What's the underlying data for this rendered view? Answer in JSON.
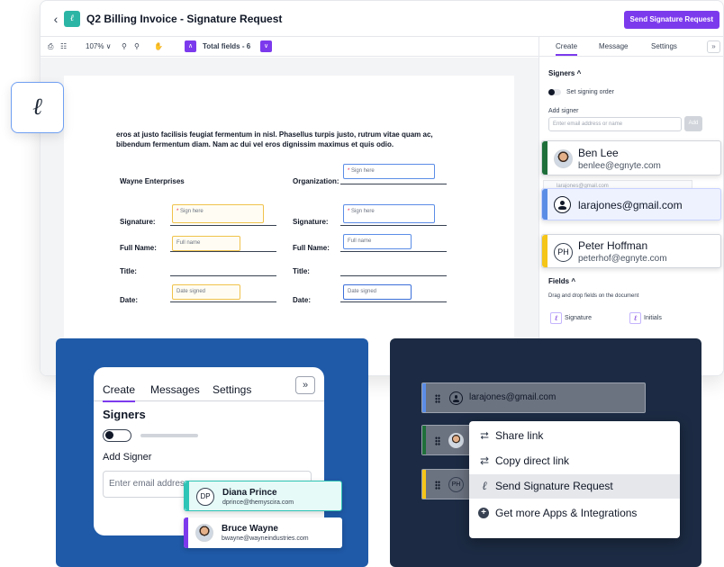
{
  "app": {
    "title": "Q2 Billing Invoice - Signature Request",
    "send_button": "Send Signature Request"
  },
  "toolbar": {
    "zoom": "107% ∨",
    "total_fields": "Total fields - 6"
  },
  "document": {
    "paragraph": "eros at justo facilisis feugiat fermentum in nisl. Phasellus turpis justo, rutrum vitae quam ac, bibendum fermentum diam. Nam ac dui vel eros dignissim maximus et quis odio.",
    "left_company": "Wayne Enterprises",
    "organization_label": "Organization:",
    "signature_label": "Signature:",
    "fullname_label": "Full Name:",
    "title_label": "Title:",
    "date_label": "Date:",
    "sign_here": "Sign here",
    "required_mark": "*",
    "full_name_placeholder": "Full name",
    "date_placeholder": "Date signed"
  },
  "panel": {
    "tabs": [
      "Create",
      "Message",
      "Settings"
    ],
    "expand": "»",
    "signers_heading": "Signers ^",
    "signing_order": "Set signing order",
    "add_signer": "Add signer",
    "email_placeholder": "Enter email address or name",
    "add_button": "Add",
    "ghost_email": "larajones@gmail.com",
    "fields_heading": "Fields ^",
    "fields_hint": "Drag and drop fields on the document",
    "field_signature": "Signature",
    "field_initials": "Initials"
  },
  "signers": [
    {
      "name": "Ben Lee",
      "email": "benlee@egnyte.com",
      "color": "#1e6f3a"
    },
    {
      "email": "larajones@gmail.com",
      "color": "#5b8de6"
    },
    {
      "initials": "PH",
      "name": "Peter Hoffman",
      "email": "peterhof@egnyte.com",
      "color": "#f5c518"
    }
  ],
  "bottom_left": {
    "tabs": [
      "Create",
      "Messages",
      "Settings"
    ],
    "expand": "»",
    "heading": "Signers",
    "add_signer": "Add Signer",
    "email_placeholder": "Enter email address",
    "signers": [
      {
        "initials": "DP",
        "name": "Diana Prince",
        "email": "dprince@themyscira.com",
        "color": "#2ec4b6"
      },
      {
        "name": "Bruce Wayne",
        "email": "bwayne@wayneindustries.com",
        "color": "#7c3aed"
      }
    ]
  },
  "bottom_right": {
    "row_email": "larajones@gmail.com",
    "row_initials": "PH",
    "menu": [
      "Share link",
      "Copy direct link",
      "Send Signature Request",
      "Get more Apps & Integrations"
    ],
    "highlighted": "Send Signature Request"
  },
  "colors": {
    "accent": "#7c3aed",
    "bottom_left_bg": "#1f5aa8",
    "bottom_right_bg": "#1c2b43"
  }
}
